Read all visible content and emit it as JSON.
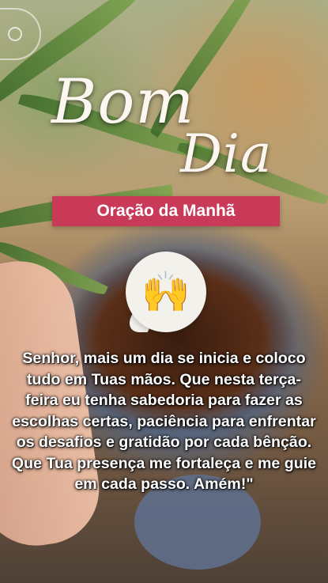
{
  "header": {
    "title_line1": "Bom",
    "title_line2": "Dia",
    "banner": "Oração da Manhã"
  },
  "sticker": {
    "emoji": "🙌",
    "icon": "raising-hands-icon"
  },
  "prayer": {
    "text": "Senhor, mais um dia se inicia e coloco tudo em Tuas mãos. Que nesta terça-feira eu tenha sabedoria para fazer as escolhas certas, paciência para enfrentar os desafios e gratidão por cada bênção. Que Tua presença me fortaleça e me guie em cada passo. Amém!\""
  },
  "controls": {
    "corner_icon": "circle-outline-icon"
  },
  "colors": {
    "banner": "#c93a59",
    "text": "#ffffff"
  }
}
